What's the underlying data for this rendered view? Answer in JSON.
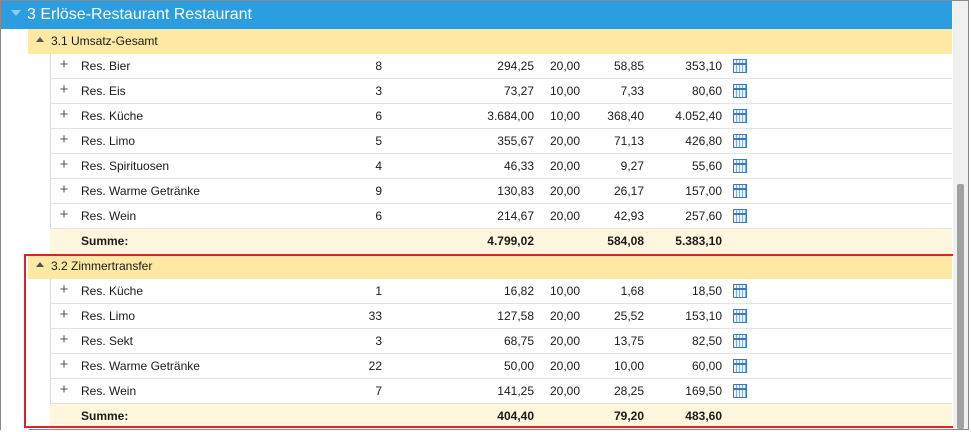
{
  "header": {
    "title": "3 Erlöse-Restaurant Restaurant"
  },
  "groups": [
    {
      "title": "3.1 Umsatz-Gesamt",
      "rows": [
        {
          "name": "Res. Bier",
          "count": "8",
          "net": "294,25",
          "rate": "20,00",
          "tax": "58,85",
          "gross": "353,10"
        },
        {
          "name": "Res. Eis",
          "count": "3",
          "net": "73,27",
          "rate": "10,00",
          "tax": "7,33",
          "gross": "80,60"
        },
        {
          "name": "Res. Küche",
          "count": "6",
          "net": "3.684,00",
          "rate": "10,00",
          "tax": "368,40",
          "gross": "4.052,40"
        },
        {
          "name": "Res. Limo",
          "count": "5",
          "net": "355,67",
          "rate": "20,00",
          "tax": "71,13",
          "gross": "426,80"
        },
        {
          "name": "Res. Spirituosen",
          "count": "4",
          "net": "46,33",
          "rate": "20,00",
          "tax": "9,27",
          "gross": "55,60"
        },
        {
          "name": "Res. Warme Getränke",
          "count": "9",
          "net": "130,83",
          "rate": "20,00",
          "tax": "26,17",
          "gross": "157,00"
        },
        {
          "name": "Res. Wein",
          "count": "6",
          "net": "214,67",
          "rate": "20,00",
          "tax": "42,93",
          "gross": "257,60"
        }
      ],
      "summary": {
        "label": "Summe:",
        "net": "4.799,02",
        "tax": "584,08",
        "gross": "5.383,10"
      }
    },
    {
      "title": "3.2 Zimmertransfer",
      "rows": [
        {
          "name": "Res. Küche",
          "count": "1",
          "net": "16,82",
          "rate": "10,00",
          "tax": "1,68",
          "gross": "18,50"
        },
        {
          "name": "Res. Limo",
          "count": "33",
          "net": "127,58",
          "rate": "20,00",
          "tax": "25,52",
          "gross": "153,10"
        },
        {
          "name": "Res. Sekt",
          "count": "3",
          "net": "68,75",
          "rate": "20,00",
          "tax": "13,75",
          "gross": "82,50"
        },
        {
          "name": "Res. Warme Getränke",
          "count": "22",
          "net": "50,00",
          "rate": "20,00",
          "tax": "10,00",
          "gross": "60,00"
        },
        {
          "name": "Res. Wein",
          "count": "7",
          "net": "141,25",
          "rate": "20,00",
          "tax": "28,25",
          "gross": "169,50"
        }
      ],
      "summary": {
        "label": "Summe:",
        "net": "404,40",
        "tax": "79,20",
        "gross": "483,60"
      }
    }
  ],
  "colors": {
    "header": "#2a9ee0",
    "group_header": "#fde9a4",
    "summary": "#fef6dd",
    "highlight": "#d9232e"
  },
  "icons": {
    "expand_row": "plus-icon",
    "collapse_group": "triangle-icon",
    "row_action": "calendar-icon"
  }
}
